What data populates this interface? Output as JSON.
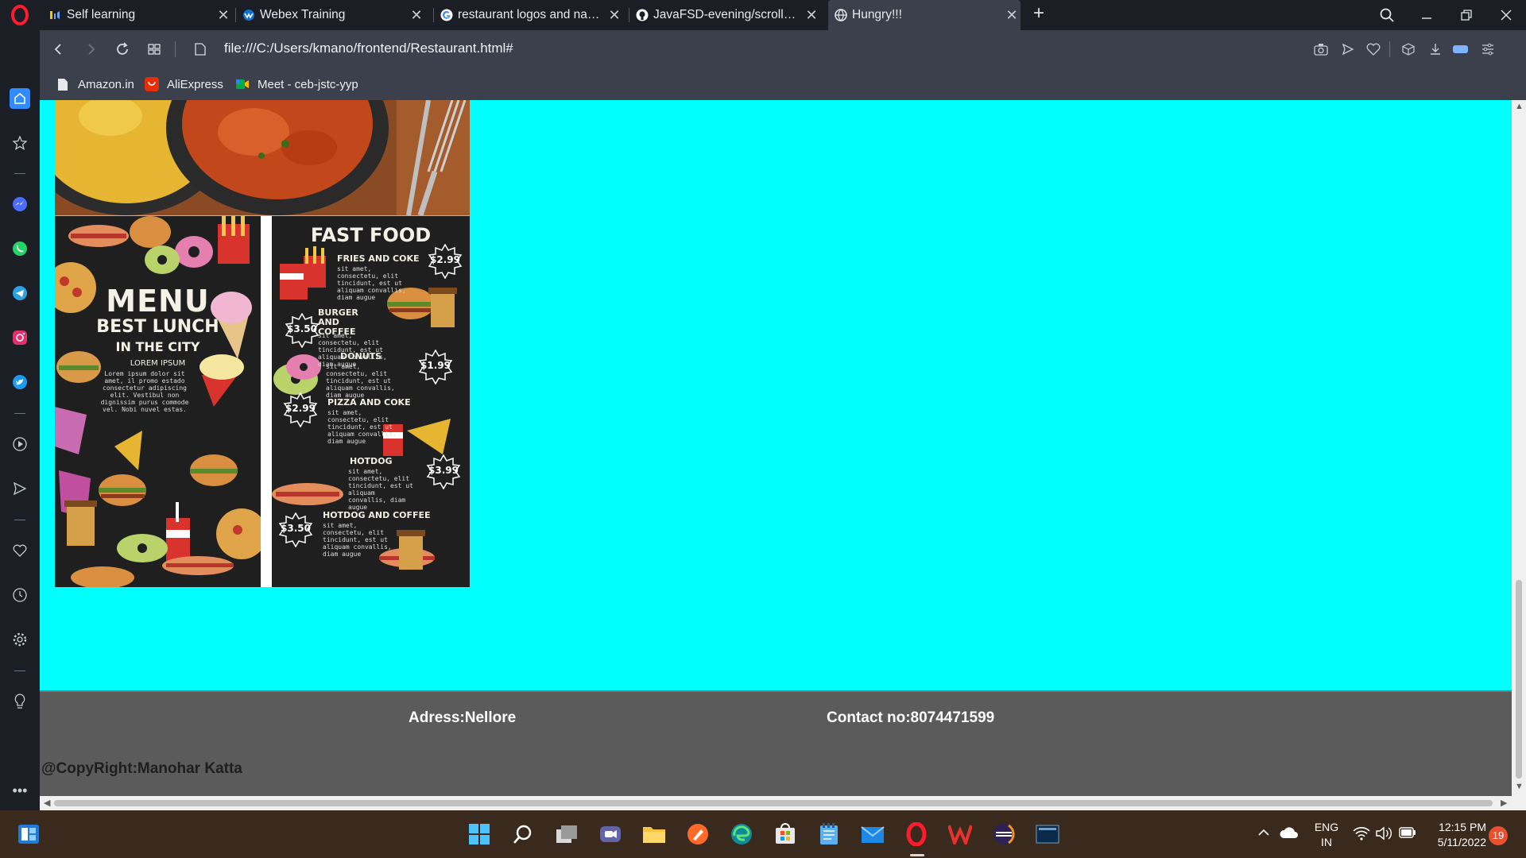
{
  "browser": {
    "tabs": [
      {
        "title": "Self learning",
        "icon": "sound-icon"
      },
      {
        "title": "Webex Training",
        "icon": "webex-icon"
      },
      {
        "title": "restaurant logos and name",
        "icon": "google-icon"
      },
      {
        "title": "JavaFSD-evening/scrollspy",
        "icon": "github-icon"
      },
      {
        "title": "Hungry!!!",
        "icon": "globe-icon",
        "active": true
      }
    ],
    "url": "file:///C:/Users/kmano/frontend/Restaurant.html#",
    "bookmarks": [
      {
        "label": "Amazon.in",
        "icon": "page-icon"
      },
      {
        "label": "AliExpress",
        "icon": "aliexpress-icon"
      },
      {
        "label": "Meet - ceb-jstc-yyp",
        "icon": "meet-icon"
      }
    ]
  },
  "page": {
    "background_color": "#00ffff",
    "menu_left": {
      "title": "MENU",
      "subtitle": "BEST LUNCH",
      "subtitle2": "IN THE CITY",
      "caption": "LOREM IPSUM",
      "body": "Lorem ipsum dolor sit amet, il promo estado consectetur adipiscing elit. Vestibul non dignissim purus commode vel. Nobi nuvel estas."
    },
    "menu_right": {
      "title": "FAST FOOD",
      "items": [
        {
          "name": "FRIES AND COKE",
          "price": "$2.99"
        },
        {
          "name": "BURGER AND COFFEE",
          "price": "$3.50"
        },
        {
          "name": "DONUTS",
          "price": "$1.99"
        },
        {
          "name": "PIZZA AND COKE",
          "price": "$2.99"
        },
        {
          "name": "HOTDOG",
          "price": "$3.99"
        },
        {
          "name": "HOTDOG AND COFFEE",
          "price": "$3.50"
        }
      ],
      "filler": "sit amet, consectetu, elit tincidunt, est ut aliquam convallis, diam augue"
    },
    "footer": {
      "address": "Adress:Nellore",
      "contact": "Contact no:8074471599",
      "copyright": "@CopyRight:Manohar Katta"
    }
  },
  "taskbar": {
    "language": "ENG",
    "region": "IN",
    "time": "12:15 PM",
    "date": "5/11/2022",
    "notifications": "19"
  }
}
